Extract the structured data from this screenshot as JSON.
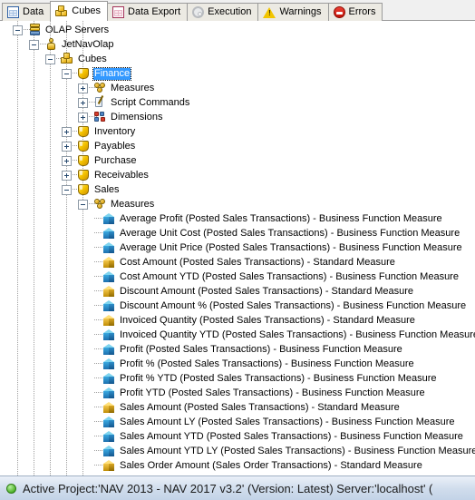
{
  "window": {
    "title": "Cubes"
  },
  "tabs": [
    {
      "label": "Data",
      "icon": "grid-blue-icon",
      "active": false
    },
    {
      "label": "Cubes",
      "icon": "cubes-icon",
      "active": true
    },
    {
      "label": "Data Export",
      "icon": "grid-pink-icon",
      "active": false
    },
    {
      "label": "Execution",
      "icon": "gear-icon",
      "active": false
    },
    {
      "label": "Warnings",
      "icon": "warning-icon",
      "active": false
    },
    {
      "label": "Errors",
      "icon": "error-icon",
      "active": false
    }
  ],
  "tree": [
    {
      "label": "OLAP Servers",
      "level": 0,
      "icon": "server-icon",
      "state": "expanded",
      "selected": false
    },
    {
      "label": "JetNavOlap",
      "level": 1,
      "icon": "pawn-icon",
      "state": "expanded",
      "selected": false
    },
    {
      "label": "Cubes",
      "level": 2,
      "icon": "cubes-icon",
      "state": "expanded",
      "selected": false
    },
    {
      "label": "Finance",
      "level": 3,
      "icon": "shield-icon",
      "state": "expanded",
      "selected": true
    },
    {
      "label": "Measures",
      "level": 4,
      "icon": "clover-icon",
      "state": "collapsed",
      "selected": false
    },
    {
      "label": "Script Commands",
      "level": 4,
      "icon": "script-icon",
      "state": "collapsed",
      "selected": false
    },
    {
      "label": "Dimensions",
      "level": 4,
      "icon": "dimension-icon",
      "state": "collapsed",
      "selected": false
    },
    {
      "label": "Inventory",
      "level": 3,
      "icon": "shield-icon",
      "state": "collapsed",
      "selected": false
    },
    {
      "label": "Payables",
      "level": 3,
      "icon": "shield-icon",
      "state": "collapsed",
      "selected": false
    },
    {
      "label": "Purchase",
      "level": 3,
      "icon": "shield-icon",
      "state": "collapsed",
      "selected": false
    },
    {
      "label": "Receivables",
      "level": 3,
      "icon": "shield-icon",
      "state": "collapsed",
      "selected": false
    },
    {
      "label": "Sales",
      "level": 3,
      "icon": "shield-icon",
      "state": "expanded",
      "selected": false
    },
    {
      "label": "Measures",
      "level": 4,
      "icon": "clover-icon",
      "state": "expanded",
      "selected": false
    },
    {
      "label": "Average Profit (Posted Sales Transactions) - Business Function Measure",
      "level": 5,
      "icon": "measure-blue-icon",
      "state": "leaf",
      "selected": false
    },
    {
      "label": "Average Unit Cost (Posted Sales Transactions) - Business Function Measure",
      "level": 5,
      "icon": "measure-blue-icon",
      "state": "leaf",
      "selected": false
    },
    {
      "label": "Average Unit Price (Posted Sales Transactions) - Business Function Measure",
      "level": 5,
      "icon": "measure-blue-icon",
      "state": "leaf",
      "selected": false
    },
    {
      "label": "Cost Amount (Posted Sales Transactions) - Standard Measure",
      "level": 5,
      "icon": "measure-gold-icon",
      "state": "leaf",
      "selected": false
    },
    {
      "label": "Cost Amount YTD (Posted Sales Transactions) - Business Function Measure",
      "level": 5,
      "icon": "measure-blue-icon",
      "state": "leaf",
      "selected": false
    },
    {
      "label": "Discount Amount (Posted Sales Transactions) - Standard Measure",
      "level": 5,
      "icon": "measure-gold-icon",
      "state": "leaf",
      "selected": false
    },
    {
      "label": "Discount Amount % (Posted Sales Transactions) - Business Function Measure",
      "level": 5,
      "icon": "measure-blue-icon",
      "state": "leaf",
      "selected": false
    },
    {
      "label": "Invoiced Quantity (Posted Sales Transactions) - Standard Measure",
      "level": 5,
      "icon": "measure-gold-icon",
      "state": "leaf",
      "selected": false
    },
    {
      "label": "Invoiced Quantity YTD (Posted Sales Transactions) - Business Function Measure",
      "level": 5,
      "icon": "measure-blue-icon",
      "state": "leaf",
      "selected": false
    },
    {
      "label": "Profit (Posted Sales Transactions) - Business Function Measure",
      "level": 5,
      "icon": "measure-blue-icon",
      "state": "leaf",
      "selected": false
    },
    {
      "label": "Profit % (Posted Sales Transactions) - Business Function Measure",
      "level": 5,
      "icon": "measure-blue-icon",
      "state": "leaf",
      "selected": false
    },
    {
      "label": "Profit % YTD (Posted Sales Transactions) - Business Function Measure",
      "level": 5,
      "icon": "measure-blue-icon",
      "state": "leaf",
      "selected": false
    },
    {
      "label": "Profit YTD (Posted Sales Transactions) - Business Function Measure",
      "level": 5,
      "icon": "measure-blue-icon",
      "state": "leaf",
      "selected": false
    },
    {
      "label": "Sales Amount (Posted Sales Transactions) - Standard Measure",
      "level": 5,
      "icon": "measure-gold-icon",
      "state": "leaf",
      "selected": false
    },
    {
      "label": "Sales Amount LY (Posted Sales Transactions) - Business Function Measure",
      "level": 5,
      "icon": "measure-blue-icon",
      "state": "leaf",
      "selected": false
    },
    {
      "label": "Sales Amount YTD (Posted Sales Transactions) - Business Function Measure",
      "level": 5,
      "icon": "measure-blue-icon",
      "state": "leaf",
      "selected": false
    },
    {
      "label": "Sales Amount YTD LY (Posted Sales Transactions) - Business Function Measure",
      "level": 5,
      "icon": "measure-blue-icon",
      "state": "leaf",
      "selected": false
    },
    {
      "label": "Sales Order Amount (Sales Order Transactions) - Standard Measure",
      "level": 5,
      "icon": "measure-gold-icon",
      "state": "leaf",
      "selected": false
    }
  ],
  "statusbar": {
    "indicator": "status-ok-dot",
    "text": "Active Project:'NAV 2013 - NAV 2017 v3.2' (Version: Latest) Server:'localhost' ("
  },
  "colors": {
    "selection": "#3399ff",
    "status_ok": "#4fb32a",
    "business_measure": "#2e8ec9",
    "standard_measure": "#d9a623",
    "statusbar_bg": "#cfdcec"
  }
}
